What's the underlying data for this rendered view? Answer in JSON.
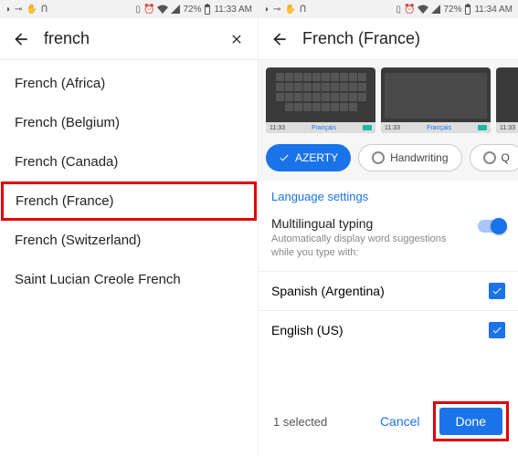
{
  "statusbar": {
    "battery": "72%",
    "time_left": "11:33 AM",
    "time_right": "11:34 AM"
  },
  "left": {
    "search_value": "french",
    "results": [
      "French (Africa)",
      "French (Belgium)",
      "French (Canada)",
      "French (France)",
      "French (Switzerland)",
      "Saint Lucian Creole French"
    ],
    "highlighted_index": 3
  },
  "right": {
    "title": "French (France)",
    "thumb_labels": {
      "azerty": "Français",
      "time": "11:33"
    },
    "layouts": {
      "selected": "AZERTY",
      "handwriting": "Handwriting",
      "more_initial": "Q"
    },
    "section_title": "Language settings",
    "multilingual": {
      "title": "Multilingual typing",
      "subtitle": "Automatically display word suggestions while you type with:",
      "enabled": true
    },
    "langs": [
      {
        "name": "Spanish (Argentina)",
        "checked": true
      },
      {
        "name": "English (US)",
        "checked": true
      }
    ],
    "footer": {
      "selected_text": "1 selected",
      "cancel": "Cancel",
      "done": "Done"
    }
  }
}
